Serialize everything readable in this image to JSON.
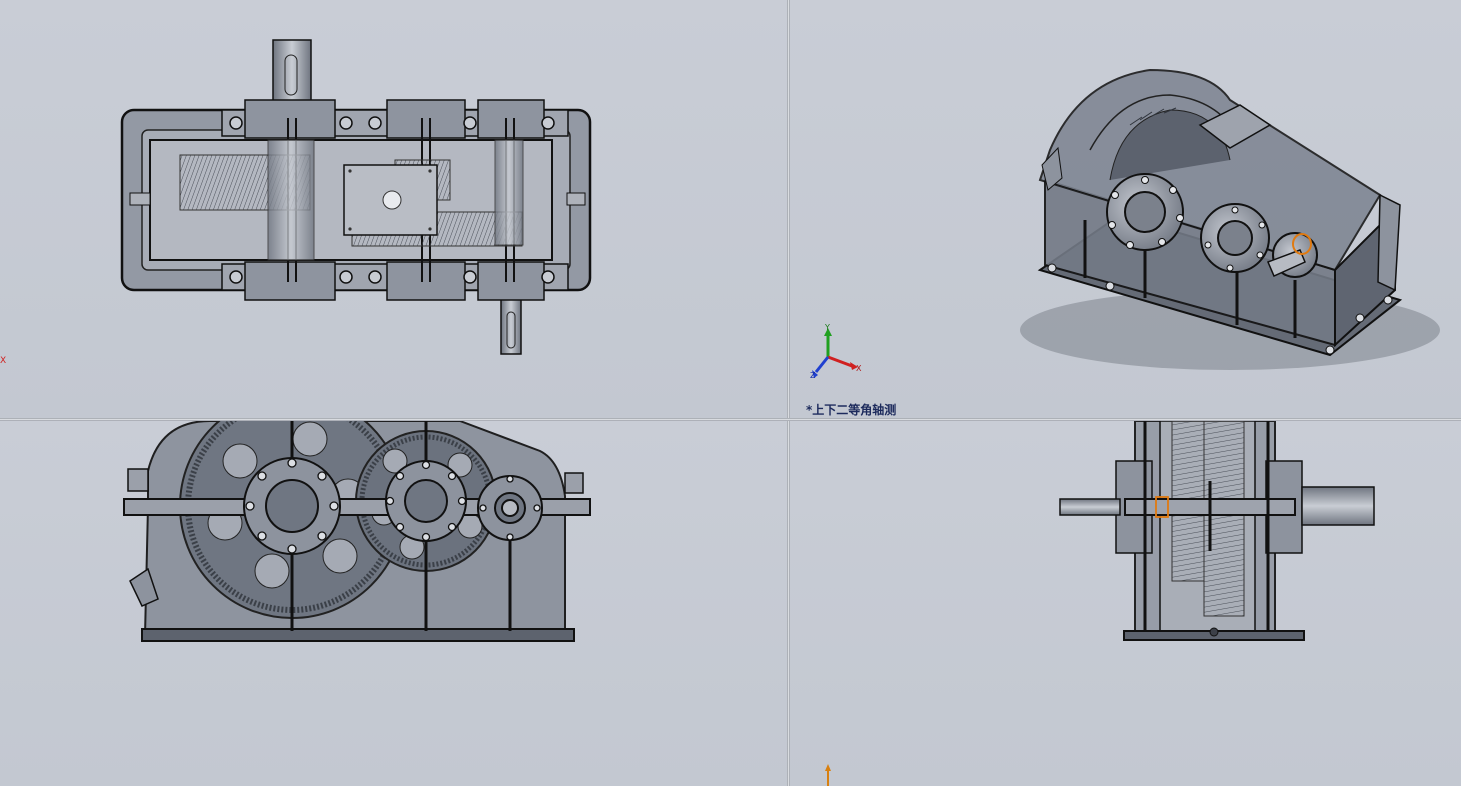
{
  "viewports": {
    "top_right": {
      "view_name": "*上下二等角轴测"
    }
  },
  "triad": {
    "x_label": "X",
    "y_label": "Y",
    "z_label": "Z"
  },
  "colors": {
    "background": "#c6cbd4",
    "body_fill": "#8d939e",
    "edge": "#111111",
    "selection": "#e07a10",
    "axis_x": "#d02020",
    "axis_y": "#20a020",
    "axis_z": "#2040d0"
  }
}
